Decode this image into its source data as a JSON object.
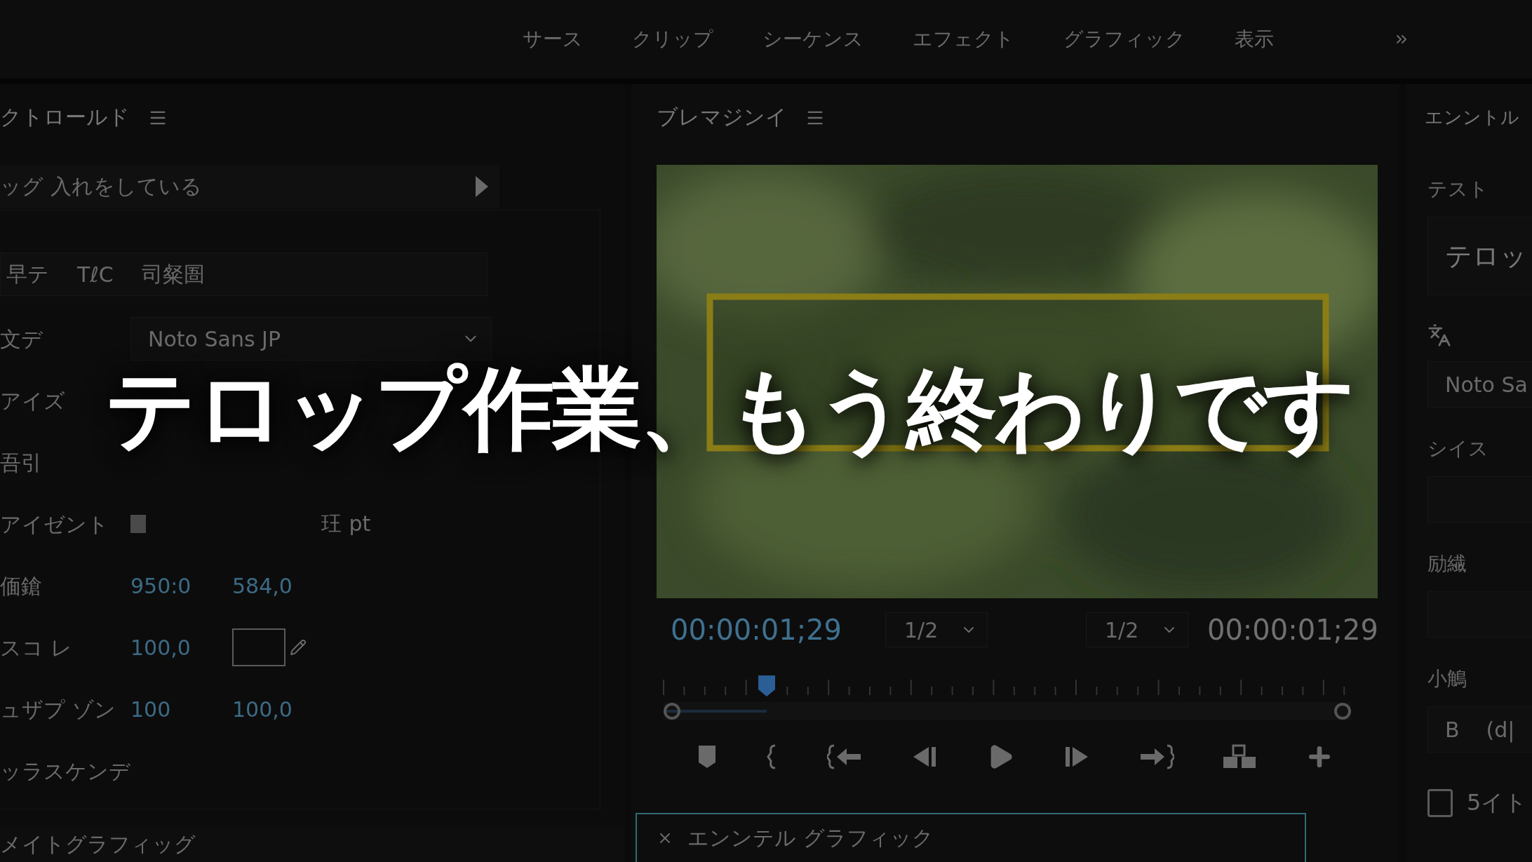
{
  "menu": {
    "items": [
      "サース",
      "クリップ",
      "シーケンス",
      "エフェクト",
      "グラフィック",
      "表示"
    ]
  },
  "left_panel": {
    "title": "クトロールド",
    "layer": "ッグ 入れをしている",
    "text_tools": [
      "早テ",
      "TℓC",
      "司粲圄"
    ],
    "rows": [
      {
        "kind": "dropdown",
        "label": "文デ",
        "value": "Noto Sans JP"
      },
      {
        "kind": "label",
        "label": "アイズ"
      },
      {
        "kind": "label",
        "label": "吾引"
      },
      {
        "kind": "swatch",
        "label": "アイゼント",
        "unit": "玨 pt"
      },
      {
        "kind": "pair",
        "label": "偭鎗",
        "values": [
          "950:0",
          "584,0"
        ]
      },
      {
        "kind": "scale",
        "label": "スコ レ",
        "values": [
          "100,0"
        ]
      },
      {
        "kind": "pair",
        "label": "ュザプ ゾン",
        "values": [
          "100",
          "100,0"
        ]
      },
      {
        "kind": "label",
        "label": "ッラスケンデ"
      }
    ]
  },
  "bottom_left_tab": "メイトグラフィッグ",
  "program": {
    "title": "ブレマジンイ",
    "timecode_current": "00:00:01;29",
    "zoom": "1/2",
    "quality": "1/2",
    "timecode_duration": "00:00:01;29",
    "playhead": {
      "level": 0.15
    }
  },
  "bottom_tab": {
    "title": "エンンテル グラフィック",
    "selected": true
  },
  "right_panel": {
    "title": "エンントル",
    "section": "テスト",
    "text_value": "テロッ",
    "font_value": "Noto Sa",
    "labels": [
      "シイス",
      "励繊",
      "小鵤"
    ],
    "style_buttons": [
      "B",
      "(d|"
    ],
    "checkbox": {
      "label": "5イト",
      "checked": false
    }
  },
  "headline": "テロップ作業、もう終わりです"
}
